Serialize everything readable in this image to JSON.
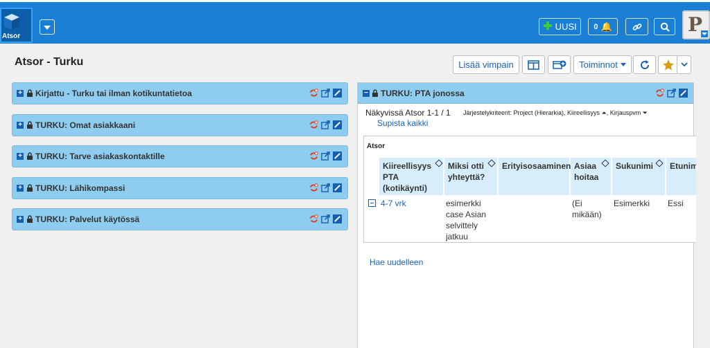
{
  "header": {
    "logo_label": "Atsor",
    "new_label": "UUSI",
    "notification_count": "0"
  },
  "page": {
    "title": "Atsor - Turku"
  },
  "actions": {
    "add_widget_label": "Lisää vimpain",
    "functions_label": "Toiminnot"
  },
  "widgets": [
    {
      "title": "Kirjattu - Turku tai ilman kotikuntatietoa"
    },
    {
      "title": "TURKU: Omat asiakkaani"
    },
    {
      "title": "TURKU: Tarve asiakaskontaktille"
    },
    {
      "title": "TURKU: Lähikompassi"
    },
    {
      "title": "TURKU: Palvelut käytössä"
    }
  ],
  "queue_panel": {
    "title": "TURKU: PTA jonossa",
    "visible_count": "Näkyvissä Atsor 1-1 / 1",
    "sort_criteria": "Järjestelykriteerit: Project (Hierarkia), Kiireellisyys ⏶, Kirjauspvm ⏷",
    "collapse_all": "Supista kaikki",
    "group_label": "Atsor",
    "columns": [
      {
        "line1": "Kiireellisyys",
        "line2": "PTA",
        "line3": "(kotikäynti)"
      },
      {
        "line1": "Miksi otti",
        "line2": "yhteyttä?",
        "line3": ""
      },
      {
        "line1": "Erityisosaaminen",
        "line2": "",
        "line3": ""
      },
      {
        "line1": "Asiaa",
        "line2": "hoitaa",
        "line3": ""
      },
      {
        "line1": "Sukunimi",
        "line2": "",
        "line3": ""
      },
      {
        "line1": "Etunim",
        "line2": "",
        "line3": ""
      }
    ],
    "row": {
      "urgency": "4-7 vrk",
      "reason": [
        "esimerkki",
        "case Asian",
        "selvittely",
        "jatkuu"
      ],
      "specialty": "",
      "handler": [
        "(Ei",
        "mikään)"
      ],
      "surname": "Esimerkki",
      "firstname": "Essi"
    },
    "refetch_label": "Hae uudelleen"
  },
  "colors": {
    "topbar": "#1a7fd4",
    "widget_header": "#8fcdf0",
    "link": "#1a62b5",
    "table_header": "#d6eefb"
  },
  "icons": [
    "cube-icon",
    "plus-icon",
    "bell-icon",
    "link-icon",
    "search-icon",
    "lock-icon",
    "refresh-icon",
    "external-link-icon",
    "edit-icon",
    "layout-icon",
    "add-widget-icon",
    "reload-icon",
    "star-icon",
    "chevron-down-icon",
    "expand-icon",
    "collapse-icon",
    "sort-icon"
  ]
}
